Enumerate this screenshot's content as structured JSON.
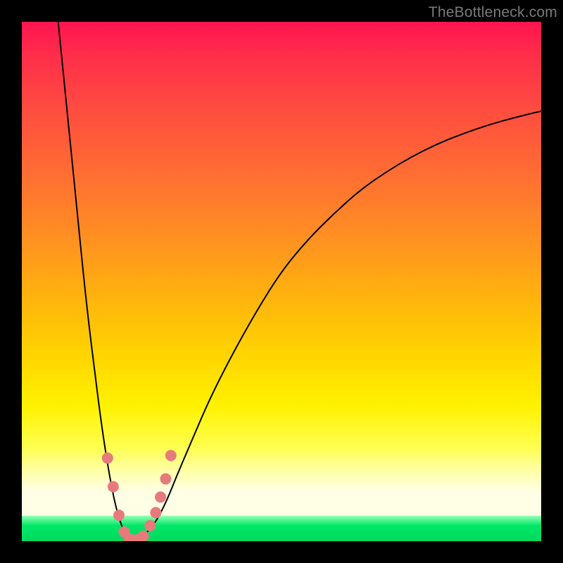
{
  "watermark": "TheBottleneck.com",
  "chart_data": {
    "type": "line",
    "title": "",
    "xlabel": "",
    "ylabel": "",
    "xlim": [
      0,
      100
    ],
    "ylim": [
      0,
      100
    ],
    "grid": false,
    "legend": false,
    "series": [
      {
        "name": "bottleneck-curve",
        "color": "#000000",
        "stroke_width": 2,
        "x": [
          7,
          8,
          9,
          10,
          11,
          12,
          13,
          14,
          15,
          16,
          17,
          18,
          19,
          20,
          21,
          22,
          24,
          26,
          28,
          30,
          33,
          36,
          40,
          45,
          50,
          55,
          60,
          65,
          70,
          75,
          80,
          85,
          90,
          95,
          100
        ],
        "y": [
          100,
          90,
          80,
          70,
          60,
          50,
          41,
          33,
          25,
          18,
          12,
          7,
          3.5,
          1.2,
          0.3,
          0.2,
          1.5,
          4,
          8,
          13,
          20,
          27,
          35,
          44,
          52,
          58,
          63,
          67.5,
          71,
          74,
          76.5,
          78.5,
          80.2,
          81.6,
          82.8
        ]
      },
      {
        "name": "threshold-markers",
        "color": "#e77b7b",
        "marker": "circle",
        "marker_radius": 8,
        "x": [
          16.5,
          17.6,
          18.7,
          19.7,
          20.7,
          21.5,
          22.3,
          23.4,
          24.7,
          25.8,
          26.7,
          27.7,
          28.7
        ],
        "y": [
          16.0,
          10.5,
          5.0,
          1.8,
          0.4,
          0.2,
          0.3,
          1.0,
          3.0,
          5.5,
          8.5,
          12.0,
          16.5
        ]
      }
    ],
    "background_gradient": {
      "type": "vertical",
      "stops": [
        {
          "pos": 0.0,
          "color": "#ff1450"
        },
        {
          "pos": 0.15,
          "color": "#ff4742"
        },
        {
          "pos": 0.4,
          "color": "#ff8b24"
        },
        {
          "pos": 0.64,
          "color": "#ffd400"
        },
        {
          "pos": 0.82,
          "color": "#ffff50"
        },
        {
          "pos": 0.905,
          "color": "#ffffe6"
        },
        {
          "pos": 0.952,
          "color": "#8dffb0"
        },
        {
          "pos": 1.0,
          "color": "#00d85e"
        }
      ]
    }
  }
}
